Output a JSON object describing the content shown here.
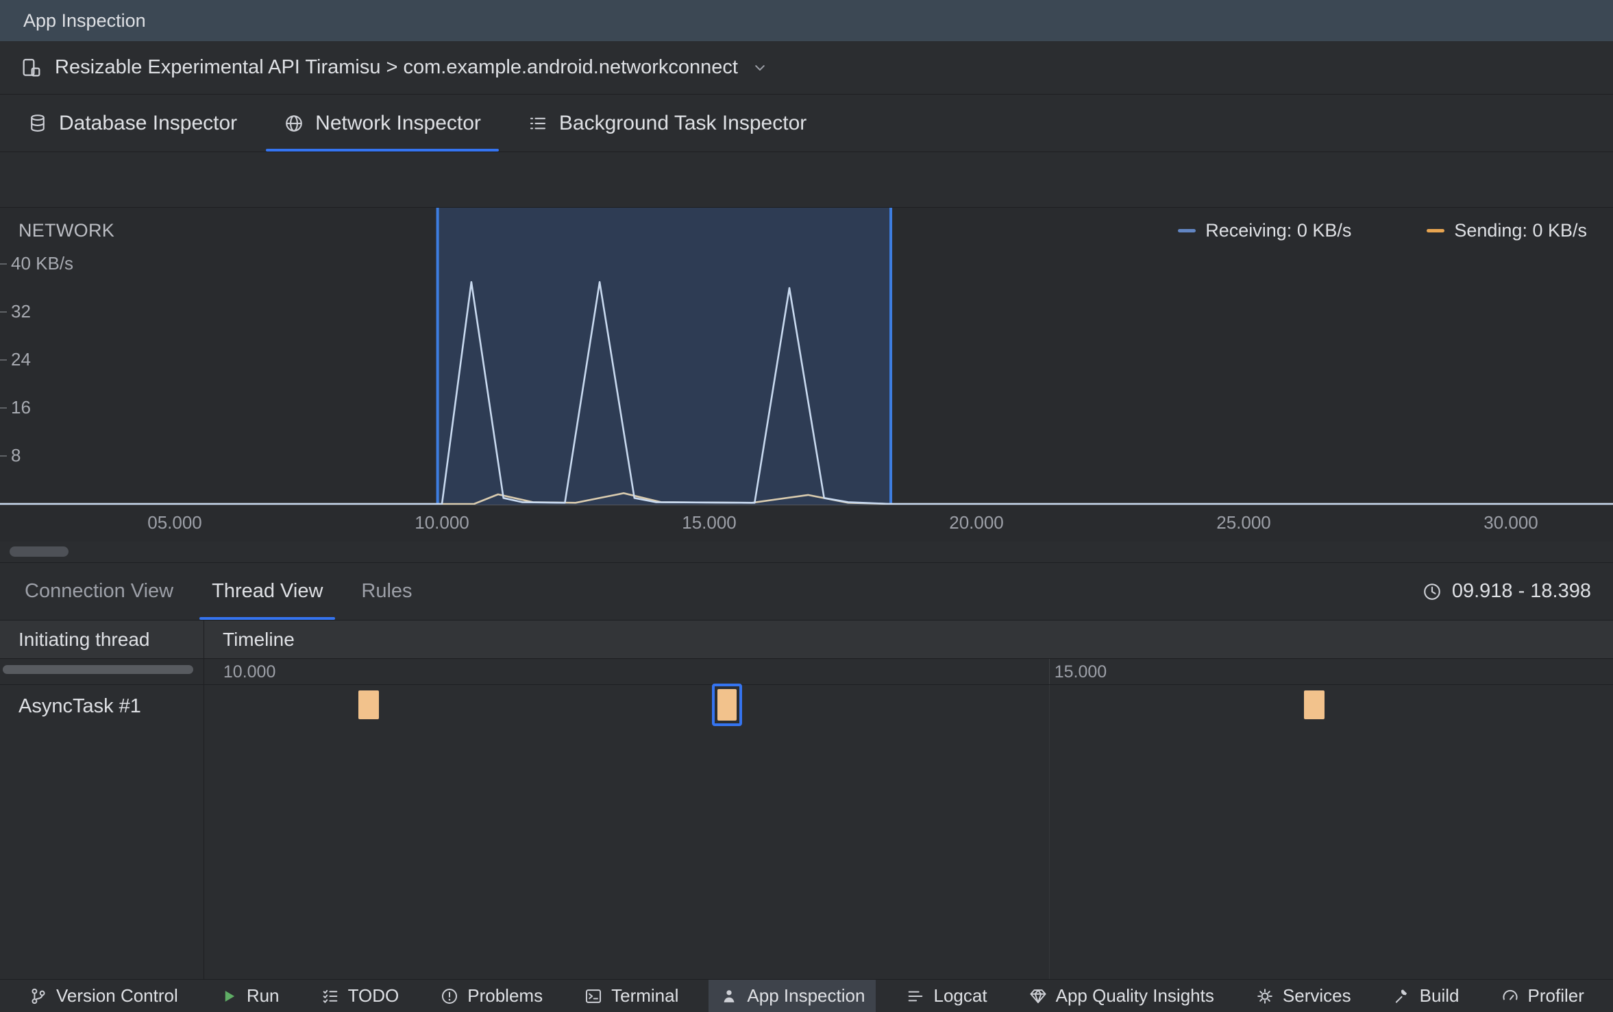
{
  "colors": {
    "accent": "#3574F0",
    "selection_border": "#3D7DE0",
    "receiving_line": "#C9DAF0",
    "receiving_legend": "#6286C3",
    "sending_line": "#DACCAF",
    "sending_legend": "#E8A551",
    "event_block": "#F2C28C",
    "run_green": "#5FAD65"
  },
  "title_bar": {
    "title": "App Inspection"
  },
  "process_selector": {
    "label": "Resizable Experimental API Tiramisu > com.example.android.networkconnect"
  },
  "inspector_tabs": {
    "items": [
      {
        "label": "Database Inspector",
        "icon": "database-icon",
        "selected": false
      },
      {
        "label": "Network Inspector",
        "icon": "globe-icon",
        "selected": true
      },
      {
        "label": "Background Task Inspector",
        "icon": "task-list-icon",
        "selected": false
      }
    ]
  },
  "chart_data": {
    "type": "area",
    "title": "NETWORK",
    "ylabel_unit": "KB/s",
    "y_max_kbps": 48,
    "x_range_seconds": [
      0,
      32
    ],
    "grid": false,
    "legend_position": "top-right",
    "y_ticks": [
      {
        "value": 40,
        "label": "40 KB/s"
      },
      {
        "value": 32,
        "label": "32"
      },
      {
        "value": 24,
        "label": "24"
      },
      {
        "value": 16,
        "label": "16"
      },
      {
        "value": 8,
        "label": "8"
      }
    ],
    "x_ticks": [
      {
        "value": 5,
        "label": "05.000"
      },
      {
        "value": 10,
        "label": "10.000"
      },
      {
        "value": 15,
        "label": "15.000"
      },
      {
        "value": 20,
        "label": "20.000"
      },
      {
        "value": 25,
        "label": "25.000"
      },
      {
        "value": 30,
        "label": "30.000"
      }
    ],
    "legend": [
      {
        "label": "Receiving: 0 KB/s",
        "series": "receiving"
      },
      {
        "label": "Sending: 0 KB/s",
        "series": "sending"
      }
    ],
    "selection": {
      "start_seconds": 9.918,
      "end_seconds": 18.398
    },
    "series": [
      {
        "name": "receiving",
        "points": [
          [
            0,
            0
          ],
          [
            10.0,
            0
          ],
          [
            10.55,
            37
          ],
          [
            11.15,
            1
          ],
          [
            11.5,
            0.3
          ],
          [
            12.3,
            0.2
          ],
          [
            12.95,
            37
          ],
          [
            13.6,
            1
          ],
          [
            14.0,
            0.3
          ],
          [
            15.85,
            0.2
          ],
          [
            16.5,
            36
          ],
          [
            17.15,
            1
          ],
          [
            17.6,
            0.3
          ],
          [
            18.4,
            0
          ],
          [
            32,
            0
          ]
        ]
      },
      {
        "name": "sending",
        "points": [
          [
            0,
            0
          ],
          [
            10.6,
            0
          ],
          [
            11.05,
            1.6
          ],
          [
            11.7,
            0.3
          ],
          [
            12.5,
            0.2
          ],
          [
            13.4,
            1.8
          ],
          [
            14.1,
            0.3
          ],
          [
            15.8,
            0.2
          ],
          [
            16.85,
            1.5
          ],
          [
            17.6,
            0.2
          ],
          [
            18.4,
            0
          ],
          [
            32,
            0
          ]
        ]
      }
    ]
  },
  "detail_panel": {
    "tabs": [
      {
        "label": "Connection View",
        "selected": false
      },
      {
        "label": "Thread View",
        "selected": true
      },
      {
        "label": "Rules",
        "selected": false
      }
    ],
    "time_range_label": "09.918 - 18.398",
    "table": {
      "thread_column_header": "Initiating thread",
      "timeline_column_header": "Timeline",
      "range_seconds": {
        "start": 9.918,
        "end": 18.398
      },
      "timeline_ticks": [
        {
          "value": 10,
          "label": "10.000"
        },
        {
          "value": 15,
          "label": "15.000"
        }
      ],
      "rows": [
        {
          "thread": "AsyncTask #1",
          "events": [
            {
              "start": 10.845,
              "duration": 0.124,
              "selected": false
            },
            {
              "start": 13.001,
              "duration": 0.124,
              "selected": true
            },
            {
              "start": 16.534,
              "duration": 0.124,
              "selected": false
            }
          ]
        }
      ]
    }
  },
  "status_bar": {
    "items": [
      {
        "label": "Version Control",
        "icon": "branch-icon",
        "selected": false
      },
      {
        "label": "Run",
        "icon": "run-icon",
        "selected": false
      },
      {
        "label": "TODO",
        "icon": "todo-icon",
        "selected": false
      },
      {
        "label": "Problems",
        "icon": "problems-icon",
        "selected": false
      },
      {
        "label": "Terminal",
        "icon": "terminal-icon",
        "selected": false
      },
      {
        "label": "App Inspection",
        "icon": "inspection-icon",
        "selected": true
      },
      {
        "label": "Logcat",
        "icon": "logcat-icon",
        "selected": false
      },
      {
        "label": "App Quality Insights",
        "icon": "insights-icon",
        "selected": false
      },
      {
        "label": "Services",
        "icon": "services-icon",
        "selected": false
      },
      {
        "label": "Build",
        "icon": "build-icon",
        "selected": false
      },
      {
        "label": "Profiler",
        "icon": "profiler-icon",
        "selected": false
      }
    ]
  }
}
